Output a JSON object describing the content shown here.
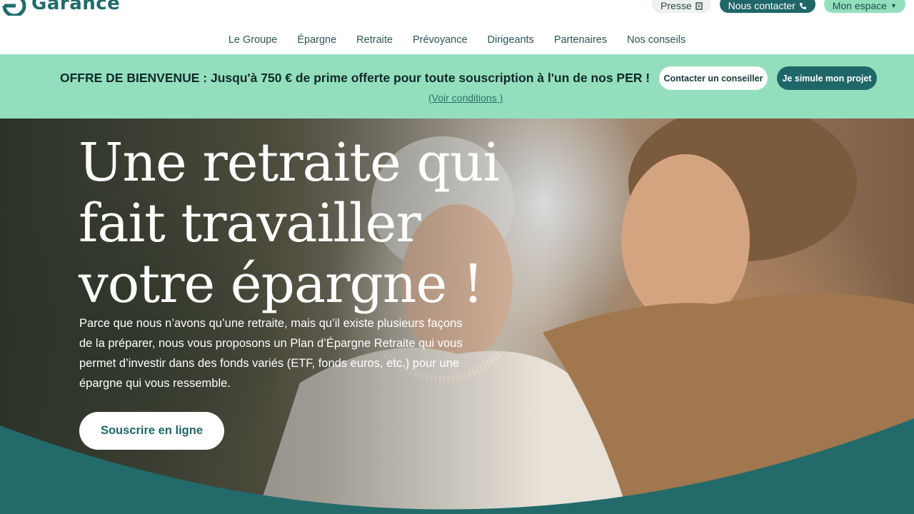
{
  "brand": {
    "logo_text": "Garance"
  },
  "header": {
    "presse_label": "Presse",
    "contact_label": "Nous contacter",
    "espace_label": "Mon espace"
  },
  "nav": {
    "items": [
      "Le Groupe",
      "Épargne",
      "Retraite",
      "Prévoyance",
      "Dirigeants",
      "Partenaires",
      "Nos conseils"
    ]
  },
  "promo": {
    "text": "OFFRE DE BIENVENUE : Jusqu'à 750 € de prime offerte pour toute souscription à l'un de nos PER !",
    "conditions_link": "(Voir conditions )",
    "btn_conseiller": "Contacter un conseiller",
    "btn_simule": "Je simule mon projet"
  },
  "hero": {
    "title": "Une retraite qui fait travailler votre épargne !",
    "description": "Parce que nous n’avons qu’une retraite, mais qu’il existe plusieurs façons de la préparer, nous vous proposons un Plan d’Épargne Retraite qui vous permet d’investir dans des fonds variés (ETF, fonds euros, etc.) pour une épargne qui vous ressemble.",
    "cta_label": "Souscrire en ligne"
  },
  "colors": {
    "brand_teal": "#1f6668",
    "mint": "#93dfbd",
    "wave": "#236a6b"
  }
}
